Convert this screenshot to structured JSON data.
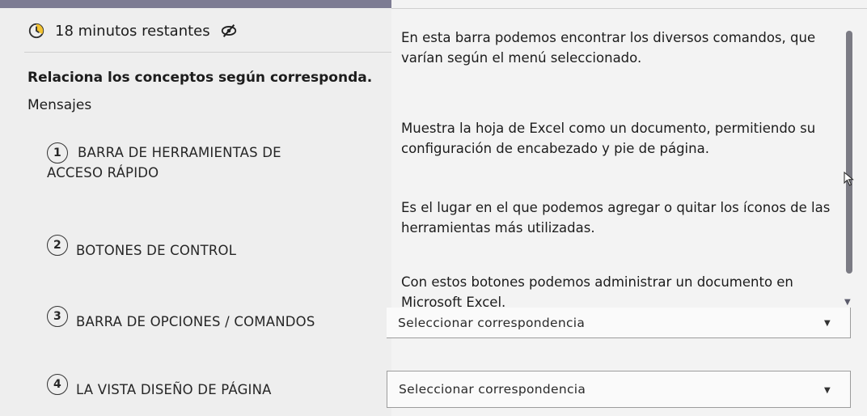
{
  "timer": {
    "text": "18 minutos restantes",
    "icon": "clock-icon",
    "hide_icon": "eye-slash-icon"
  },
  "question": {
    "instruction": "Relaciona los conceptos según corresponda.",
    "section_label": "Mensajes",
    "items": [
      {
        "number": "1",
        "label": "BARRA DE HERRAMIENTAS DE ACCESO RÁPIDO"
      },
      {
        "number": "2",
        "label": "BOTONES DE CONTROL"
      },
      {
        "number": "3",
        "label": "BARRA DE OPCIONES / COMANDOS"
      },
      {
        "number": "4",
        "label": "LA VISTA DISEÑO DE PÁGINA"
      }
    ]
  },
  "descriptions": [
    "En esta barra podemos encontrar los diversos comandos, que varían según el menú seleccionado.",
    "Muestra la hoja de Excel como un documento, permitiendo su configuración de encabezado y pie de página.",
    "Es el lugar en el que podemos agregar o quitar los íconos de las herramientas más utilizadas.",
    "Con estos botones podemos administrar un documento en Microsoft Excel."
  ],
  "selects": [
    {
      "value": "Seleccionar correspondencia"
    },
    {
      "value": "Seleccionar correspondencia"
    }
  ]
}
